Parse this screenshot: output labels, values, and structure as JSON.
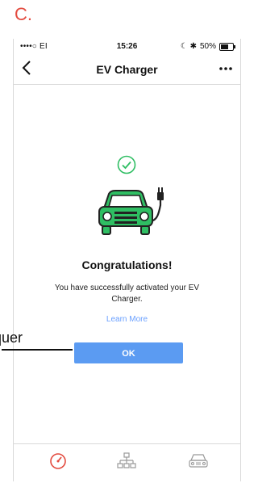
{
  "step": {
    "label": "C."
  },
  "statusbar": {
    "carrier": "••••○ EI",
    "time": "15:26",
    "battery": "50%"
  },
  "navbar": {
    "back_icon": "chevron-left-icon",
    "title": "EV Charger",
    "more_icon": "more-icon"
  },
  "content": {
    "success_icon": "check-circle-icon",
    "car_icon": "ev-car-icon",
    "title": "Congratulations!",
    "subtitle": "You have successfully activated your EV Charger.",
    "learn_more": "Learn More",
    "ok_label": "OK"
  },
  "tabbar": {
    "tabs": [
      {
        "icon": "dashboard-gauge-icon",
        "active": true
      },
      {
        "icon": "network-icon",
        "active": false
      },
      {
        "icon": "car-icon",
        "active": false
      }
    ]
  },
  "annotation": {
    "text": "quer"
  },
  "colors": {
    "accent_red": "#e34b3f",
    "button_blue": "#5b9bf2",
    "link_blue": "#6aa0ff",
    "success_green": "#2fbe63",
    "car_green": "#2fbe63"
  }
}
